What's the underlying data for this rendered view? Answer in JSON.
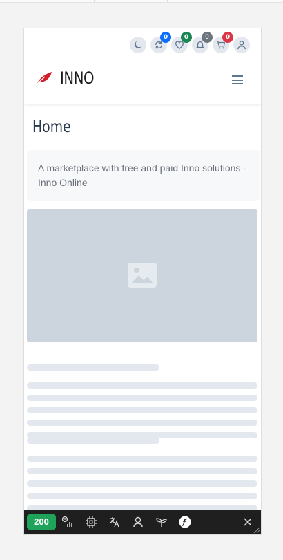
{
  "badges": {
    "updates": "0",
    "wishlist": "0",
    "notifications": "0",
    "cart": "0"
  },
  "brand": {
    "name": "INNO"
  },
  "page": {
    "title": "Home",
    "description": "A marketplace with free and paid Inno solutions - Inno Online"
  },
  "debug": {
    "status_code": "200"
  },
  "icons": [
    "moon-icon",
    "refresh-icon",
    "heart-icon",
    "bell-icon",
    "cart-icon",
    "user-icon",
    "leaf-logo-icon",
    "menu-icon",
    "image-icon",
    "timer-icon",
    "cpu-icon",
    "translate-icon",
    "person-icon",
    "sprout-icon",
    "symfony-icon",
    "close-icon"
  ],
  "colors": {
    "updates": "#0d6efd",
    "wishlist": "#198754",
    "notifications": "#6c757d",
    "cart": "#dc3545",
    "brand": "#d31e2b",
    "status": "#1fa35a"
  }
}
